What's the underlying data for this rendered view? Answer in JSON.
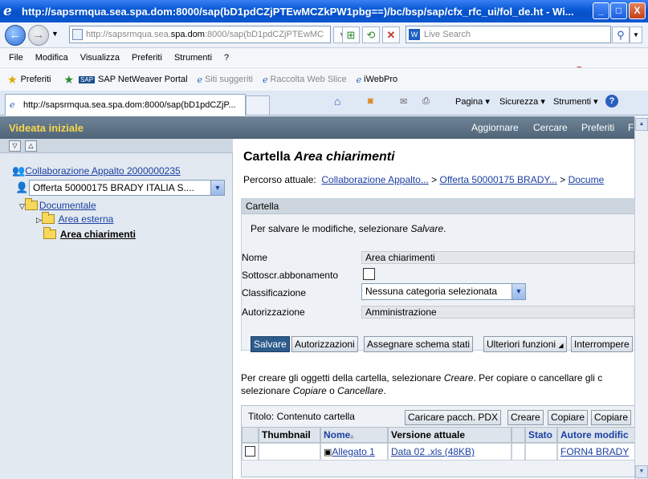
{
  "window": {
    "title": "http://sapsrmqua.sea.spa.dom:8000/sap(bD1pdCZjPTEwMCZkPW1pbg==)/bc/bsp/sap/cfx_rfc_ui/fol_de.ht - Wi...",
    "min": "_",
    "max": "□",
    "close": "X"
  },
  "nav": {
    "back": "←",
    "forward": "→",
    "address_gray1": "http://sapsrmqua.sea.",
    "address_dark": "spa.dom",
    "address_gray2": ":8000/sap(bD1pdCZjPTEwMC",
    "search_placeholder": "Live Search",
    "live": "W"
  },
  "menu": [
    "File",
    "Modifica",
    "Visualizza",
    "Preferiti",
    "Strumenti",
    "?"
  ],
  "favorites": {
    "preferiti": "Preferiti",
    "items": [
      "SAP NetWeaver Portal",
      "Siti suggeriti",
      "Raccolta Web Slice",
      "iWebPro"
    ]
  },
  "tab": {
    "label": "http://sapsrmqua.sea.spa.dom:8000/sap(bD1pdCZjP..."
  },
  "commands": {
    "pagina": "Pagina",
    "sicurezza": "Sicurezza",
    "strumenti": "Strumenti"
  },
  "sap": {
    "brand": "Videata iniziale",
    "links": [
      "Aggiornare",
      "Cercare",
      "Preferiti",
      "F"
    ]
  },
  "tree": {
    "root": "Collaborazione Appalto 2000000235",
    "dropdown": "Offerta 50000175 BRADY ITALIA S....",
    "documentale": "Documentale",
    "area_esterna": "Area esterna",
    "area_chiarimenti": "Area chiarimenti"
  },
  "main": {
    "title_prefix": "Cartella ",
    "title_name": "Area chiarimenti",
    "path_label": "Percorso attuale:",
    "path_1": "Collaborazione Appalto...",
    "path_sep": ">",
    "path_2": "Offerta 50000175 BRADY...",
    "path_3": "Docume"
  },
  "panel": {
    "header": "Cartella",
    "hint_pre": "Per salvare le modifiche, selezionare ",
    "hint_em": "Salvare",
    "hint_post": ".",
    "nome_label": "Nome",
    "nome_value": "Area chiarimenti",
    "sott_label": "Sottoscr.abbonamento",
    "class_label": "Classificazione",
    "class_value": "Nessuna categoria selezionata",
    "auth_label": "Autorizzazione",
    "auth_value": "Amministrazione"
  },
  "buttons": {
    "salvare": "Salvare",
    "autorizzazioni": "Autorizzazioni",
    "assegnare": "Assegnare schema stati",
    "ulteriori": "Ulteriori funzioni",
    "interrompere": "Interrompere"
  },
  "info": {
    "p1": "Per creare gli oggetti della cartella, selezionare ",
    "em1": "Creare",
    "p2": ". Per copiare o cancellare gli c",
    "p3": "selezionare ",
    "em2": "Copiare",
    "p4": " o ",
    "em3": "Cancellare",
    "p5": "."
  },
  "table": {
    "title": "Titolo: Contenuto cartella",
    "buttons": [
      "Caricare pacch. PDX",
      "Creare",
      "Copiare",
      "Copiare"
    ],
    "headers": [
      "Thumbnail",
      "Nome",
      "Versione attuale",
      "Stato",
      "Autore modific"
    ],
    "rows": [
      {
        "nome": "Allegato 1",
        "versione": "Data 02 .xls (48KB)",
        "stato": "",
        "autore": "FORN4 BRADY"
      }
    ]
  }
}
